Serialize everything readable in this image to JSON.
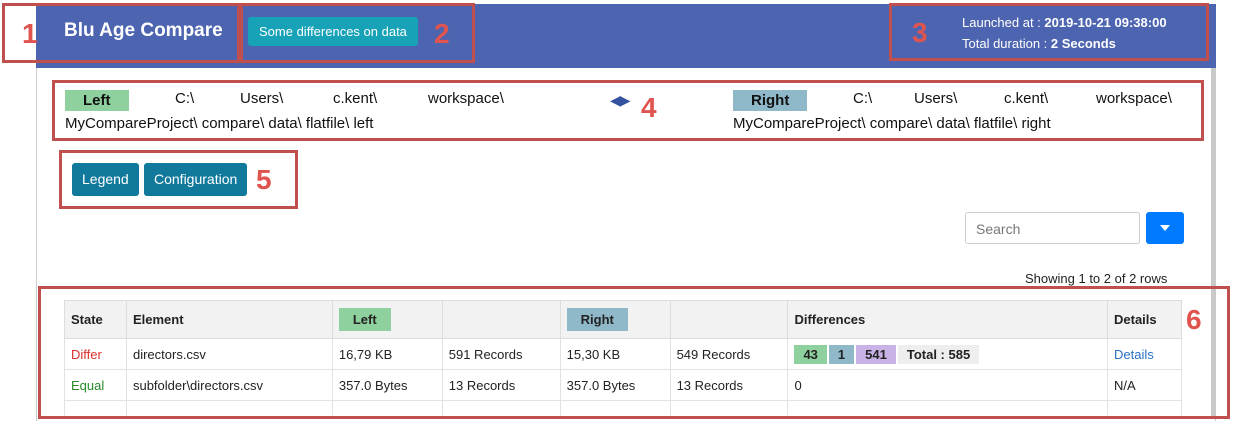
{
  "header": {
    "app_name": "Blu Age Compare",
    "status_badge": "Some differences on data",
    "launched_label": "Launched at : ",
    "launched_value": "2019-10-21 09:38:00",
    "duration_label": "Total duration : ",
    "duration_value": "2 Seconds"
  },
  "paths": {
    "left_tag": "Left",
    "left_line1": [
      "C:\\",
      "Users\\",
      "c.kent\\",
      "workspace\\"
    ],
    "left_line2": "MyCompareProject\\ compare\\ data\\ flatfile\\ left",
    "right_tag": "Right",
    "right_line1": [
      "C:\\",
      "Users\\",
      "c.kent\\",
      "workspace\\"
    ],
    "right_line2": "MyCompareProject\\ compare\\ data\\ flatfile\\ right",
    "swap_arrows": "◀▶"
  },
  "buttons": {
    "legend": "Legend",
    "configuration": "Configuration"
  },
  "search": {
    "placeholder": "Search"
  },
  "pagination": {
    "showing": "Showing 1 to 2 of 2 rows"
  },
  "table": {
    "headers": {
      "state": "State",
      "element": "Element",
      "left": "Left",
      "right": "Right",
      "differences": "Differences",
      "details": "Details"
    },
    "rows": [
      {
        "state": "Differ",
        "element": "directors.csv",
        "left_size": "16,79 KB",
        "left_records": "591 Records",
        "right_size": "15,30 KB",
        "right_records": "549 Records",
        "diff_a": "43",
        "diff_b": "1",
        "diff_c": "541",
        "diff_total": "Total : 585",
        "details": "Details"
      },
      {
        "state": "Equal",
        "element": "subfolder\\directors.csv",
        "left_size": "357.0 Bytes",
        "left_records": "13 Records",
        "right_size": "357.0 Bytes",
        "right_records": "13 Records",
        "differences": "0",
        "details": "N/A"
      }
    ]
  },
  "annotations": [
    "1",
    "2",
    "3",
    "4",
    "5",
    "6"
  ],
  "colors": {
    "header_bg": "#4d65b0",
    "badge": "#17a2b8",
    "button": "#117a9c",
    "annotation": "#c0504d",
    "left_tag": "#8fd19e",
    "right_tag": "#8fb8c9"
  }
}
